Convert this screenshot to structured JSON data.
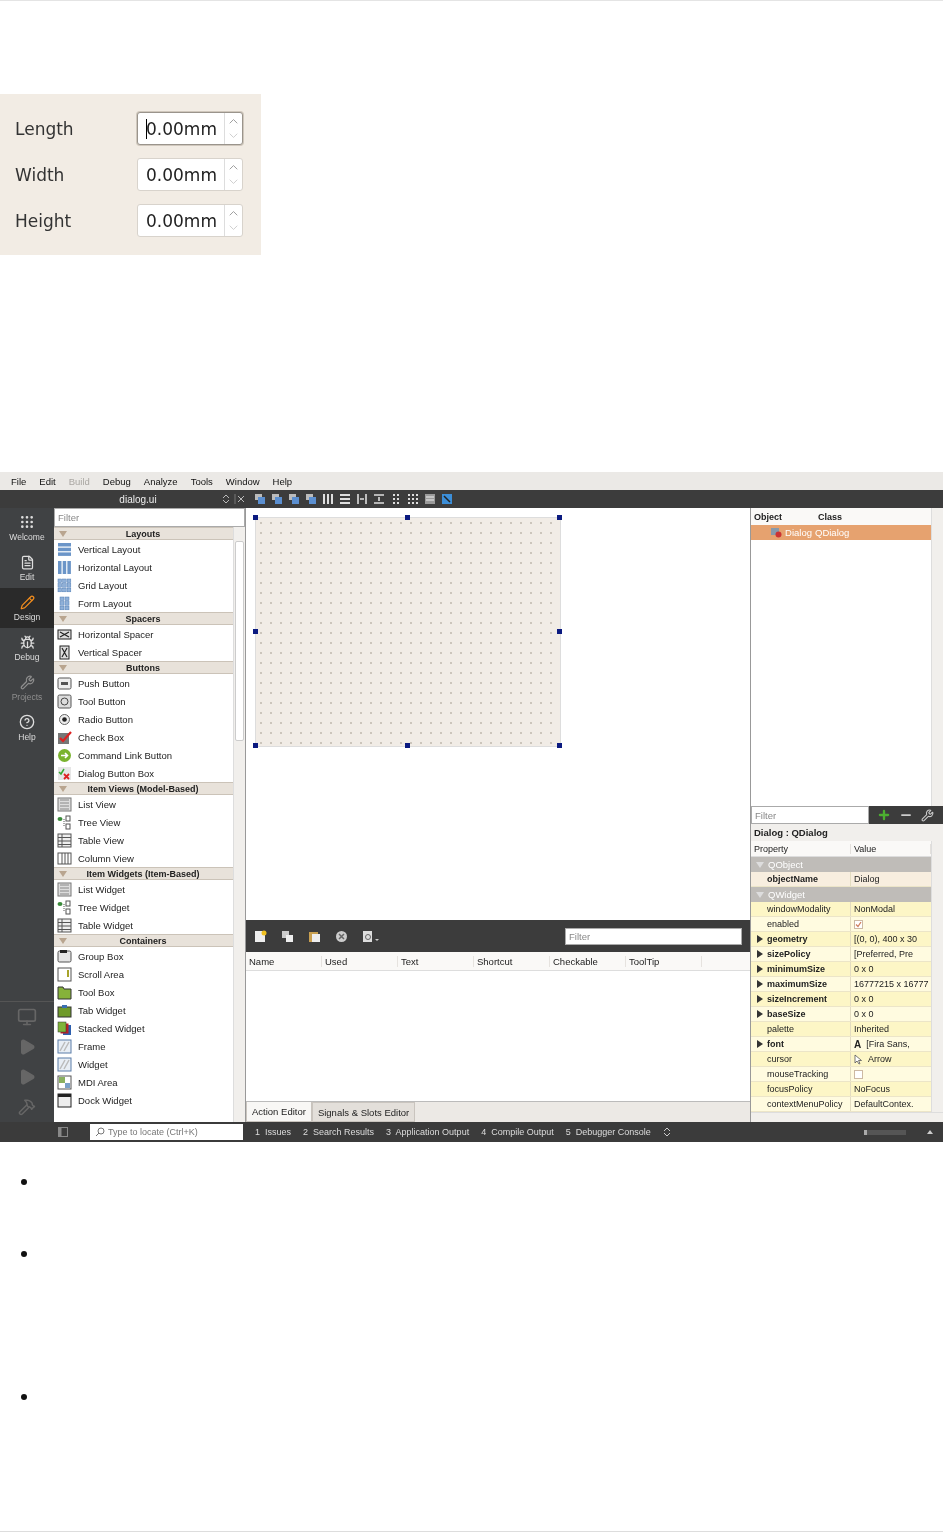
{
  "spin_form": {
    "rows": [
      {
        "label": "Length",
        "value": "0.00mm",
        "focused": true
      },
      {
        "label": "Width",
        "value": "0.00mm",
        "focused": false
      },
      {
        "label": "Height",
        "value": "0.00mm",
        "focused": false
      }
    ]
  },
  "ide": {
    "menu": [
      {
        "label": "File",
        "disabled": false
      },
      {
        "label": "Edit",
        "disabled": false
      },
      {
        "label": "Build",
        "disabled": true
      },
      {
        "label": "Debug",
        "disabled": false
      },
      {
        "label": "Analyze",
        "disabled": false
      },
      {
        "label": "Tools",
        "disabled": false
      },
      {
        "label": "Window",
        "disabled": false
      },
      {
        "label": "Help",
        "disabled": false
      }
    ],
    "document": {
      "title": "dialog.ui"
    },
    "modes": [
      {
        "label": "Welcome",
        "selected": false,
        "disabled": false
      },
      {
        "label": "Edit",
        "selected": false,
        "disabled": false
      },
      {
        "label": "Design",
        "selected": true,
        "disabled": false
      },
      {
        "label": "Debug",
        "selected": false,
        "disabled": false
      },
      {
        "label": "Projects",
        "selected": false,
        "disabled": true
      },
      {
        "label": "Help",
        "selected": false,
        "disabled": false
      }
    ],
    "widget_box": {
      "filter_placeholder": "Filter",
      "categories": [
        {
          "title": "Layouts",
          "expanded": true,
          "items": [
            "Vertical Layout",
            "Horizontal Layout",
            "Grid Layout",
            "Form Layout"
          ]
        },
        {
          "title": "Spacers",
          "expanded": true,
          "items": [
            "Horizontal Spacer",
            "Vertical Spacer"
          ]
        },
        {
          "title": "Buttons",
          "expanded": true,
          "items": [
            "Push Button",
            "Tool Button",
            "Radio Button",
            "Check Box",
            "Command Link Button",
            "Dialog Button Box"
          ]
        },
        {
          "title": "Item Views (Model-Based)",
          "expanded": true,
          "items": [
            "List View",
            "Tree View",
            "Table View",
            "Column View"
          ]
        },
        {
          "title": "Item Widgets (Item-Based)",
          "expanded": true,
          "items": [
            "List Widget",
            "Tree Widget",
            "Table Widget"
          ]
        },
        {
          "title": "Containers",
          "expanded": true,
          "items": [
            "Group Box",
            "Scroll Area",
            "Tool Box",
            "Tab Widget",
            "Stacked Widget",
            "Frame",
            "Widget",
            "MDI Area",
            "Dock Widget"
          ]
        }
      ]
    },
    "action_editor": {
      "filter_placeholder": "Filter",
      "columns": [
        "Name",
        "Used",
        "Text",
        "Shortcut",
        "Checkable",
        "ToolTip"
      ],
      "tabs": [
        {
          "label": "Action Editor",
          "selected": true
        },
        {
          "label": "Signals & Slots Editor",
          "selected": false
        }
      ]
    },
    "object_inspector": {
      "columns": [
        "Object",
        "Class"
      ],
      "rows": [
        {
          "object": "Dialog",
          "class": "QDialog",
          "selected": true
        }
      ]
    },
    "property_editor": {
      "filter_placeholder": "Filter",
      "title": "Dialog : QDialog",
      "columns": [
        "Property",
        "Value"
      ],
      "rows": [
        {
          "kind": "group",
          "name": "QObject"
        },
        {
          "kind": "text",
          "name": "objectName",
          "value": "Dialog",
          "expandable": false
        },
        {
          "kind": "group",
          "name": "QWidget"
        },
        {
          "kind": "text",
          "name": "windowModality",
          "value": "NonModal",
          "expandable": false
        },
        {
          "kind": "checkbox",
          "name": "enabled",
          "checked": true,
          "expandable": false
        },
        {
          "kind": "text",
          "name": "geometry",
          "value": "[(0, 0), 400 x 30",
          "expandable": true
        },
        {
          "kind": "text",
          "name": "sizePolicy",
          "value": "[Preferred, Pre",
          "expandable": true
        },
        {
          "kind": "text",
          "name": "minimumSize",
          "value": "0 x 0",
          "expandable": true
        },
        {
          "kind": "text",
          "name": "maximumSize",
          "value": "16777215 x 16777",
          "expandable": true
        },
        {
          "kind": "text",
          "name": "sizeIncrement",
          "value": "0 x 0",
          "expandable": true
        },
        {
          "kind": "text",
          "name": "baseSize",
          "value": "0 x 0",
          "expandable": true
        },
        {
          "kind": "text",
          "name": "palette",
          "value": "Inherited",
          "expandable": false
        },
        {
          "kind": "font",
          "name": "font",
          "glyph": "A",
          "value": "[Fira Sans,",
          "expandable": true
        },
        {
          "kind": "cursor",
          "name": "cursor",
          "value": "Arrow",
          "expandable": false
        },
        {
          "kind": "checkbox",
          "name": "mouseTracking",
          "checked": false,
          "expandable": false
        },
        {
          "kind": "text",
          "name": "focusPolicy",
          "value": "NoFocus",
          "expandable": false
        },
        {
          "kind": "text",
          "name": "contextMenuPolicy",
          "value": "DefaultContex.",
          "expandable": false
        }
      ]
    },
    "status_bar": {
      "locate_placeholder": "Type to locate (Ctrl+K)",
      "progress": {
        "level": 0.08
      },
      "panes": [
        {
          "number": "1",
          "label": "Issues"
        },
        {
          "number": "2",
          "label": "Search Results"
        },
        {
          "number": "3",
          "label": "Application Output"
        },
        {
          "number": "4",
          "label": "Compile Output"
        },
        {
          "number": "5",
          "label": "Debugger Console"
        }
      ]
    }
  }
}
